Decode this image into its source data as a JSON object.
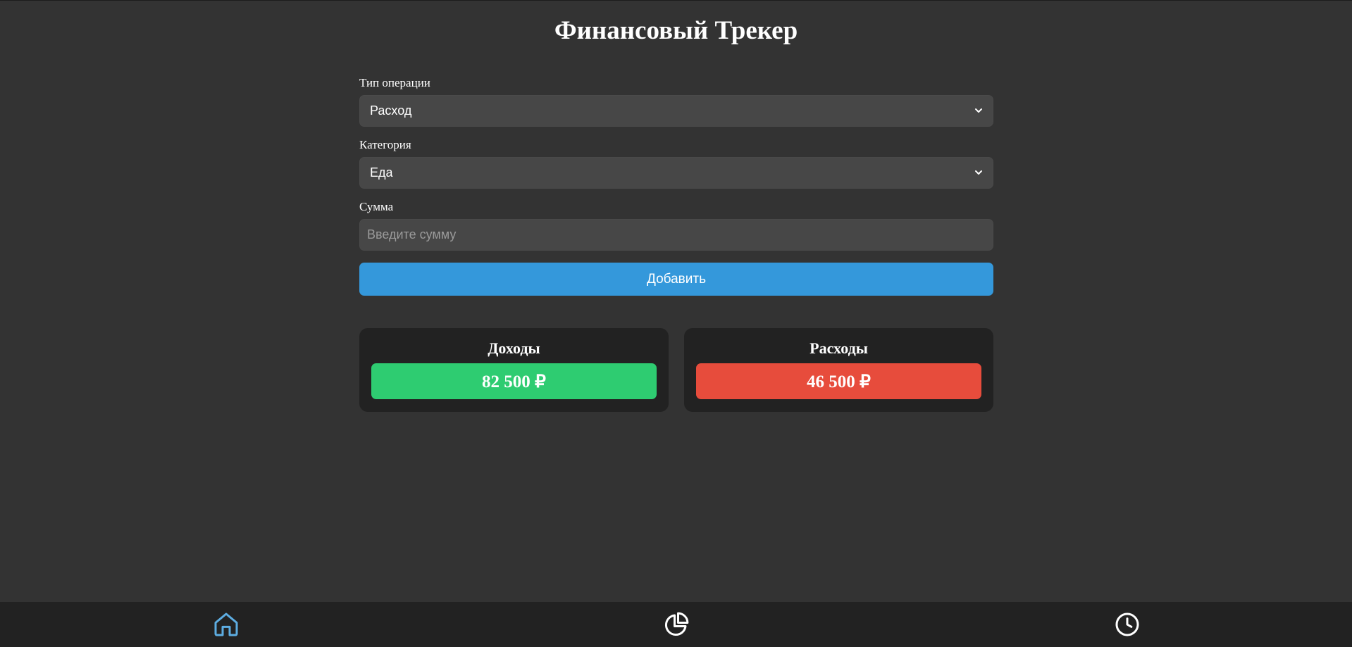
{
  "header": {
    "title": "Финансовый Трекер"
  },
  "form": {
    "type_label": "Тип операции",
    "type_value": "Расход",
    "category_label": "Категория",
    "category_value": "Еда",
    "amount_label": "Сумма",
    "amount_placeholder": "Введите сумму",
    "amount_value": "",
    "add_label": "Добавить"
  },
  "summary": {
    "income_title": "Доходы",
    "income_value": "82 500 ₽",
    "expense_title": "Расходы",
    "expense_value": "46 500 ₽"
  },
  "colors": {
    "background": "#333333",
    "accent": "#3498db",
    "income": "#2ecc71",
    "expense": "#e74c3c",
    "nav_active": "#5dade2"
  },
  "nav": {
    "items": [
      {
        "icon": "home-icon",
        "active": true
      },
      {
        "icon": "pie-chart-icon",
        "active": false
      },
      {
        "icon": "clock-icon",
        "active": false
      }
    ]
  }
}
